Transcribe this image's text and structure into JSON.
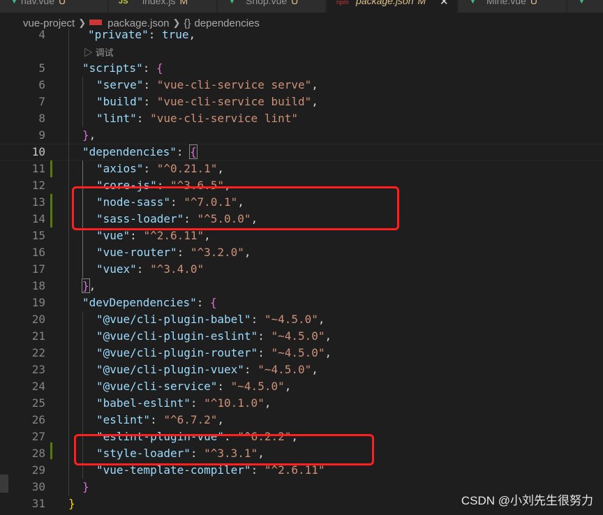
{
  "tabs": [
    {
      "name": "nav.vue",
      "mod": "U",
      "icon": "vue-icon"
    },
    {
      "name": "index.js",
      "mod": "M",
      "icon": "js-icon"
    },
    {
      "name": "Shop.vue",
      "mod": "U",
      "icon": "vue-icon"
    },
    {
      "name": "package.json",
      "mod": "M",
      "icon": "npm-icon",
      "active": true
    },
    {
      "name": "Mine.vue",
      "mod": "U",
      "icon": "vue-icon"
    }
  ],
  "breadcrumb": {
    "project": "vue-project",
    "file": "package.json",
    "braces": "{}",
    "node": "dependencies"
  },
  "codelens": "调试",
  "lines": [
    {
      "n": "4",
      "parts": [
        [
          "k",
          "\"private\""
        ],
        [
          "p",
          ": "
        ],
        [
          "k",
          "true"
        ],
        [
          "p",
          ","
        ]
      ]
    },
    {
      "n": "5",
      "parts": [
        [
          "k",
          "\"scripts\""
        ],
        [
          "p",
          ": "
        ],
        [
          "b",
          "{"
        ]
      ]
    },
    {
      "n": "6",
      "parts": [
        [
          "k",
          "\"serve\""
        ],
        [
          "p",
          ": "
        ],
        [
          "s",
          "\"vue-cli-service serve\""
        ],
        [
          "p",
          ","
        ]
      ]
    },
    {
      "n": "7",
      "parts": [
        [
          "k",
          "\"build\""
        ],
        [
          "p",
          ": "
        ],
        [
          "s",
          "\"vue-cli-service build\""
        ],
        [
          "p",
          ","
        ]
      ]
    },
    {
      "n": "8",
      "parts": [
        [
          "k",
          "\"lint\""
        ],
        [
          "p",
          ": "
        ],
        [
          "s",
          "\"vue-cli-service lint\""
        ]
      ]
    },
    {
      "n": "9",
      "parts": [
        [
          "b",
          "}"
        ],
        [
          "p",
          ","
        ]
      ]
    },
    {
      "n": "10",
      "parts": [
        [
          "k",
          "\"dependencies\""
        ],
        [
          "p",
          ": "
        ],
        [
          "b",
          "{"
        ]
      ]
    },
    {
      "n": "11",
      "parts": [
        [
          "k",
          "\"axios\""
        ],
        [
          "p",
          ": "
        ],
        [
          "s",
          "\"^0.21.1\""
        ],
        [
          "p",
          ","
        ]
      ]
    },
    {
      "n": "12",
      "parts": [
        [
          "k",
          "\"core-js\""
        ],
        [
          "p",
          ": "
        ],
        [
          "s",
          "\"^3.6.5\""
        ],
        [
          "p",
          ","
        ]
      ]
    },
    {
      "n": "13",
      "parts": [
        [
          "k",
          "\"node-sass\""
        ],
        [
          "p",
          ": "
        ],
        [
          "s",
          "\"^7.0.1\""
        ],
        [
          "p",
          ","
        ]
      ]
    },
    {
      "n": "14",
      "parts": [
        [
          "k",
          "\"sass-loader\""
        ],
        [
          "p",
          ": "
        ],
        [
          "s",
          "\"^5.0.0\""
        ],
        [
          "p",
          ","
        ]
      ]
    },
    {
      "n": "15",
      "parts": [
        [
          "k",
          "\"vue\""
        ],
        [
          "p",
          ": "
        ],
        [
          "s",
          "\"^2.6.11\""
        ],
        [
          "p",
          ","
        ]
      ]
    },
    {
      "n": "16",
      "parts": [
        [
          "k",
          "\"vue-router\""
        ],
        [
          "p",
          ": "
        ],
        [
          "s",
          "\"^3.2.0\""
        ],
        [
          "p",
          ","
        ]
      ]
    },
    {
      "n": "17",
      "parts": [
        [
          "k",
          "\"vuex\""
        ],
        [
          "p",
          ": "
        ],
        [
          "s",
          "\"^3.4.0\""
        ]
      ]
    },
    {
      "n": "18",
      "parts": [
        [
          "b",
          "}"
        ],
        [
          "p",
          ","
        ]
      ]
    },
    {
      "n": "19",
      "parts": [
        [
          "k",
          "\"devDependencies\""
        ],
        [
          "p",
          ": "
        ],
        [
          "b",
          "{"
        ]
      ]
    },
    {
      "n": "20",
      "parts": [
        [
          "k",
          "\"@vue/cli-plugin-babel\""
        ],
        [
          "p",
          ": "
        ],
        [
          "s",
          "\"~4.5.0\""
        ],
        [
          "p",
          ","
        ]
      ]
    },
    {
      "n": "21",
      "parts": [
        [
          "k",
          "\"@vue/cli-plugin-eslint\""
        ],
        [
          "p",
          ": "
        ],
        [
          "s",
          "\"~4.5.0\""
        ],
        [
          "p",
          ","
        ]
      ]
    },
    {
      "n": "22",
      "parts": [
        [
          "k",
          "\"@vue/cli-plugin-router\""
        ],
        [
          "p",
          ": "
        ],
        [
          "s",
          "\"~4.5.0\""
        ],
        [
          "p",
          ","
        ]
      ]
    },
    {
      "n": "23",
      "parts": [
        [
          "k",
          "\"@vue/cli-plugin-vuex\""
        ],
        [
          "p",
          ": "
        ],
        [
          "s",
          "\"~4.5.0\""
        ],
        [
          "p",
          ","
        ]
      ]
    },
    {
      "n": "24",
      "parts": [
        [
          "k",
          "\"@vue/cli-service\""
        ],
        [
          "p",
          ": "
        ],
        [
          "s",
          "\"~4.5.0\""
        ],
        [
          "p",
          ","
        ]
      ]
    },
    {
      "n": "25",
      "parts": [
        [
          "k",
          "\"babel-eslint\""
        ],
        [
          "p",
          ": "
        ],
        [
          "s",
          "\"^10.1.0\""
        ],
        [
          "p",
          ","
        ]
      ]
    },
    {
      "n": "26",
      "parts": [
        [
          "k",
          "\"eslint\""
        ],
        [
          "p",
          ": "
        ],
        [
          "s",
          "\"^6.7.2\""
        ],
        [
          "p",
          ","
        ]
      ]
    },
    {
      "n": "27",
      "parts": [
        [
          "k",
          "\"eslint-plugin-vue\""
        ],
        [
          "p",
          ": "
        ],
        [
          "s",
          "\"^6.2.2\""
        ],
        [
          "p",
          ","
        ]
      ]
    },
    {
      "n": "28",
      "parts": [
        [
          "k",
          "\"style-loader\""
        ],
        [
          "p",
          ": "
        ],
        [
          "s",
          "\"^3.3.1\""
        ],
        [
          "p",
          ","
        ]
      ]
    },
    {
      "n": "29",
      "parts": [
        [
          "k",
          "\"vue-template-compiler\""
        ],
        [
          "p",
          ": "
        ],
        [
          "s",
          "\"^2.6.11\""
        ]
      ]
    },
    {
      "n": "30",
      "parts": [
        [
          "b",
          "}"
        ]
      ]
    },
    {
      "n": "31",
      "parts": [
        [
          "b1",
          "}"
        ]
      ]
    }
  ],
  "watermark": "CSDN @小刘先生很努力"
}
